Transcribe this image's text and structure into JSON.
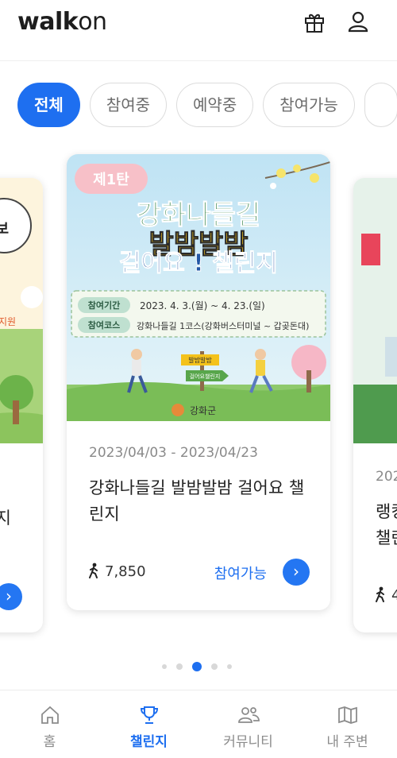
{
  "app": {
    "logo_bold": "walk",
    "logo_light": "on"
  },
  "header": {
    "gift_icon": "gift-icon",
    "user_icon": "user-icon"
  },
  "filters": [
    {
      "label": "전체",
      "active": true
    },
    {
      "label": "참여중",
      "active": false
    },
    {
      "label": "예약중",
      "active": false
    },
    {
      "label": "참여가능",
      "active": false
    }
  ],
  "cards": {
    "left": {
      "title_fragment": "지",
      "poster_text": "역보",
      "poster_sub": "지원"
    },
    "main": {
      "poster": {
        "badge": "제1탄",
        "headline_1": "강화나들길",
        "headline_2": "발밤발밤",
        "headline_3": "걸어요 ! 챌린지",
        "period_label": "참여기간",
        "period_value": "2023. 4. 3.(월) ~ 4. 23.(일)",
        "course_label": "참여코스",
        "course_value": "강화나들길 1코스(강화버스터미널 ~ 갑곶돈대)",
        "sign_1": "발밤발밤",
        "sign_2": "걸어요챌린지",
        "org": "강화군"
      },
      "date_range": "2023/04/03 - 2023/04/23",
      "title": "강화나들길 발밤발밤 걸어요 챌린지",
      "walkers": "7,850",
      "status": "참여가능"
    },
    "right": {
      "date_fragment": "202",
      "title_fragment_1": "랭킹",
      "title_fragment_2": "챌린",
      "walkers_fragment": "4"
    }
  },
  "pagination": {
    "count": 5,
    "active_index": 2
  },
  "bottom_nav": [
    {
      "label": "홈",
      "icon": "home-icon",
      "active": false
    },
    {
      "label": "챌린지",
      "icon": "trophy-icon",
      "active": true
    },
    {
      "label": "커뮤니티",
      "icon": "community-icon",
      "active": false
    },
    {
      "label": "내 주변",
      "icon": "map-icon",
      "active": false
    }
  ],
  "colors": {
    "accent": "#1e6ff0",
    "inactive": "#8c8c8c"
  }
}
